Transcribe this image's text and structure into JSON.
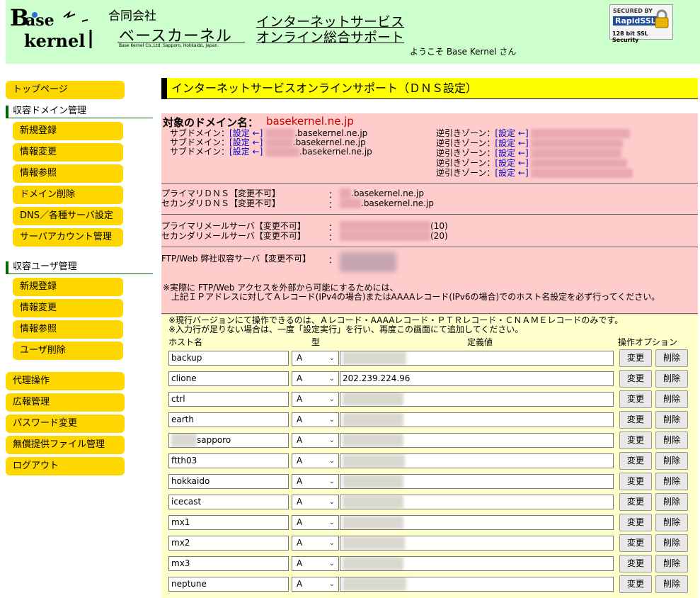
{
  "header": {
    "logo_text_line1": "Base",
    "logo_text_line2": "kernel",
    "company_type": "合同会社",
    "company_name": "ベースカーネル",
    "company_address": "Base Kernel Co.,Ltd.  Sapporo, Hokkaido, Japan.",
    "service_title_line1": "インターネットサービス",
    "service_title_line2": "オンライン総合サポート",
    "welcome": "ようこそ Base Kernel さん",
    "ssl": {
      "top": "SECURED BY",
      "brand": "RapidSSL",
      "bottom": "128 bit SSL Security"
    }
  },
  "sidebar": {
    "top": "トップページ",
    "domain_section": "収容ドメイン管理",
    "domain_items": [
      "新規登録",
      "情報変更",
      "情報参照",
      "ドメイン削除",
      "DNS／各種サーバ設定",
      "サーバアカウント管理"
    ],
    "user_section": "収容ユーザ管理",
    "user_items": [
      "新規登録",
      "情報変更",
      "情報参照",
      "ユーザ削除"
    ],
    "bottom_items": [
      "代理操作",
      "広報管理",
      "パスワード変更",
      "無償提供ファイル管理",
      "ログアウト"
    ]
  },
  "main": {
    "heading": "インターネットサービスオンラインサポート（ＤＮＳ設定）",
    "domain_label": "対象のドメイン名：",
    "domain_name": "basekernel.ne.jp",
    "subdomain_label": "サブドメイン：",
    "link_setting": "[設定 ←]",
    "subdomain_suffix": ".basekernel.ne.jp",
    "subdomains": [
      "techno",
      "manta",
      "develop"
    ],
    "reverse_label": "逆引きゾーン：",
    "reverse_count": 5,
    "primary_dns_label": "プライマリＤＮＳ【変更不可】",
    "secondary_dns_label": "セカンダリＤＮＳ【変更不可】",
    "primary_dns_value": ".basekernel.ne.jp",
    "secondary_dns_value": ".basekernel.ne.jp",
    "primary_mail_label": "プライマリメールサーバ【変更不可】",
    "secondary_mail_label": "セカンダリメールサーバ【変更不可】",
    "primary_mail_pref": "(10)",
    "secondary_mail_pref": "(20)",
    "ftp_label": "FTP/Web 弊社収容サーバ【変更不可】",
    "colon": "：",
    "note_pink_line1": "※実際に FTP/Web アクセスを外部から可能にするためには、",
    "note_pink_line2": "上記ＩＰアドレスに対してＡレコード(IPv4の場合)またはAAAAレコード(IPv6の場合)でのホスト名設定を必ず行ってください。",
    "note_yellow_line1": "※現行バージョンにて操作できるのは、Ａレコード・AAAAレコード・ＰＴＲレコード・ＣＮＡＭＥレコードのみです。",
    "note_yellow_line2": "※入力行が足りない場合は、一度「設定実行」を行い、再度この画面にて追加してください。",
    "col_host": "ホスト名",
    "col_type": "型",
    "col_value": "定義値",
    "col_ops": "操作オプション",
    "btn_edit": "変更",
    "btn_delete": "削除",
    "records": [
      {
        "host": "backup",
        "type": "A",
        "value": ""
      },
      {
        "host": "clione",
        "type": "A",
        "value": "202.239.224.96"
      },
      {
        "host": "ctrl",
        "type": "A",
        "value": ""
      },
      {
        "host": "earth",
        "type": "A",
        "value": ""
      },
      {
        "host": "sapporo",
        "type": "A",
        "value": ""
      },
      {
        "host": "ftth03",
        "type": "A",
        "value": ""
      },
      {
        "host": "hokkaido",
        "type": "A",
        "value": ""
      },
      {
        "host": "icecast",
        "type": "A",
        "value": ""
      },
      {
        "host": "mx1",
        "type": "A",
        "value": ""
      },
      {
        "host": "mx2",
        "type": "A",
        "value": ""
      },
      {
        "host": "mx3",
        "type": "A",
        "value": ""
      },
      {
        "host": "neptune",
        "type": "A",
        "value": ""
      }
    ]
  }
}
